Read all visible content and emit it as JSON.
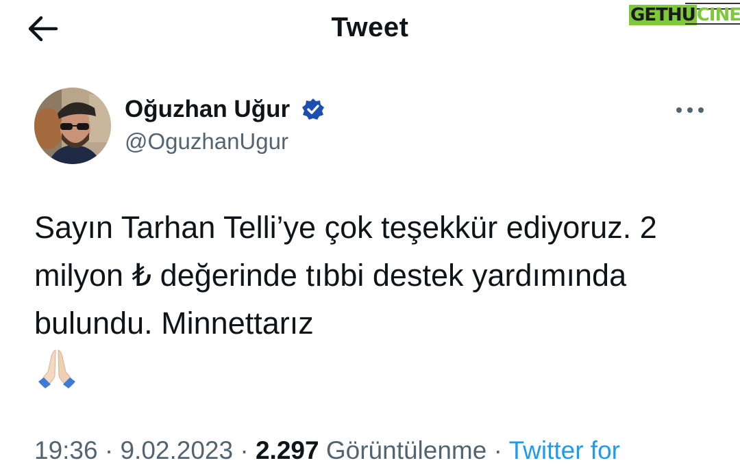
{
  "header": {
    "title": "Tweet",
    "back_icon": "arrow-left-icon"
  },
  "watermark": {
    "part1": "GETHU",
    "part2": "CINEMA"
  },
  "author": {
    "name": "Oğuzhan Uğur",
    "handle": "@OguzhanUgur",
    "verified": true,
    "verified_color": "#1d4fb0"
  },
  "tweet": {
    "text": "Sayın Tarhan Telli’ye çok teşekkür ediyoruz. 2 milyon ₺ değerinde tıbbi destek yardımında bulundu. Minnettarız",
    "emoji": "🙏🏻"
  },
  "meta": {
    "time": "19:36",
    "date": "9.02.2023",
    "views_count": "2.297",
    "views_label": "Görüntülenme",
    "source": "Twitter for",
    "separator": "·"
  },
  "colors": {
    "text": "#0f1419",
    "muted": "#536471",
    "link": "#1d9bf0"
  }
}
